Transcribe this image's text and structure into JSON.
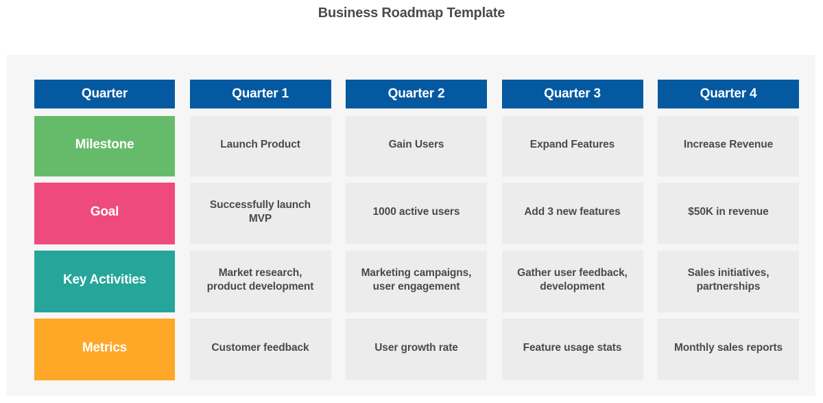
{
  "title": "Business Roadmap Template",
  "colors": {
    "header": "#0559a0",
    "milestone": "#66bb6a",
    "goal": "#ef4a7d",
    "key_activities": "#26a69a",
    "metrics": "#ffa726",
    "cell": "#ececec",
    "panel": "#f6f6f6",
    "text": "#4a4a4a"
  },
  "header": {
    "corner": "Quarter",
    "quarters": [
      "Quarter 1",
      "Quarter 2",
      "Quarter 3",
      "Quarter 4"
    ]
  },
  "rows": [
    {
      "label": "Milestone",
      "cells": [
        "Launch Product",
        "Gain Users",
        "Expand Features",
        "Increase Revenue"
      ]
    },
    {
      "label": "Goal",
      "cells": [
        "Successfully launch MVP",
        "1000 active users",
        "Add 3 new features",
        "$50K in revenue"
      ]
    },
    {
      "label": "Key Activities",
      "cells": [
        "Market research, product development",
        "Marketing campaigns, user engagement",
        "Gather user feedback, development",
        "Sales initiatives, partnerships"
      ]
    },
    {
      "label": "Metrics",
      "cells": [
        "Customer feedback",
        "User growth rate",
        "Feature usage stats",
        "Monthly sales reports"
      ]
    }
  ]
}
